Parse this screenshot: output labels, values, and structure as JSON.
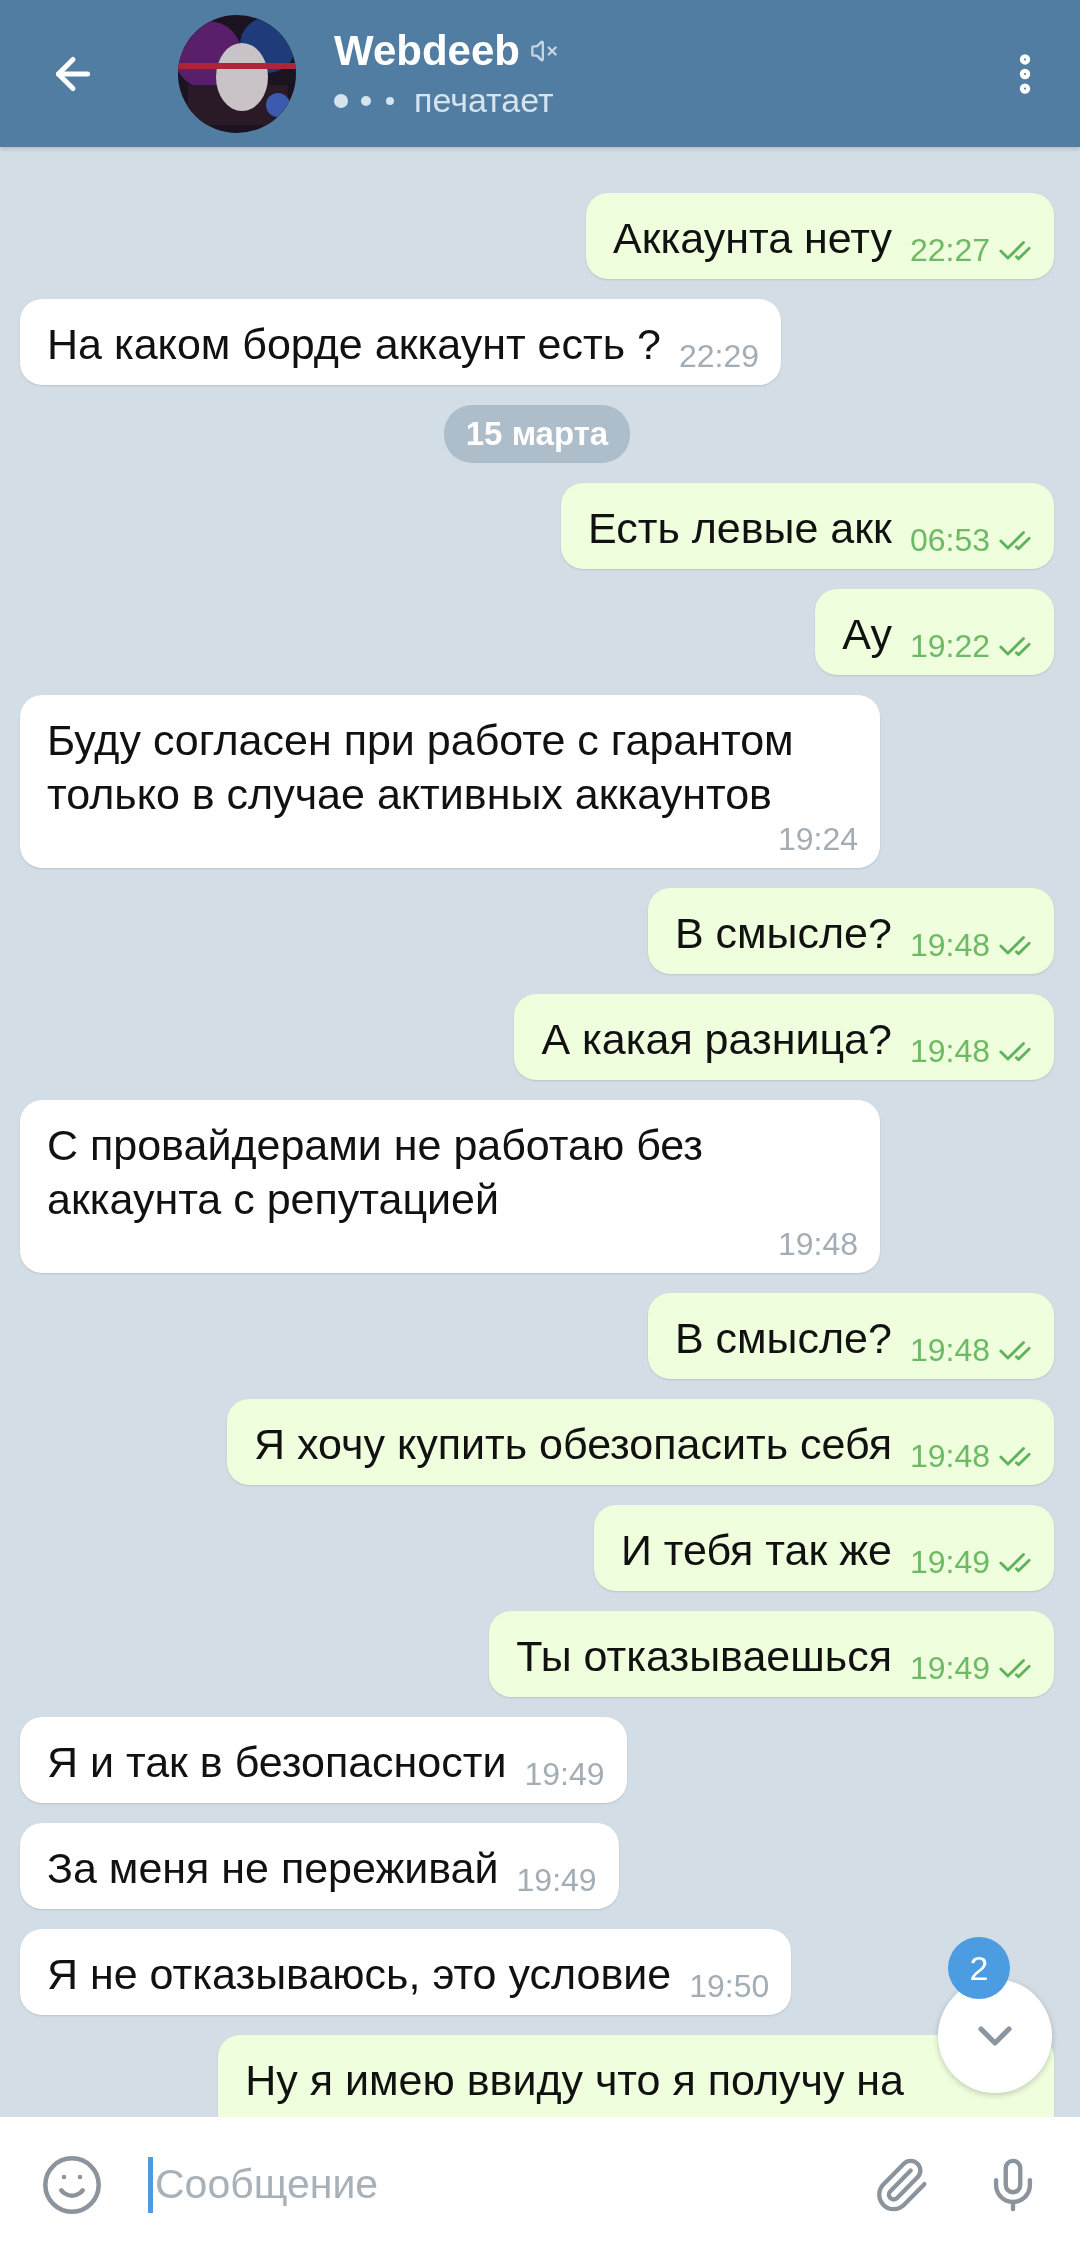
{
  "header": {
    "name": "Webdeeb",
    "muted": true,
    "status": "печатает"
  },
  "messages": [
    {
      "kind": "out",
      "text": "Аккаунта нету",
      "time": "22:27",
      "read": true
    },
    {
      "kind": "in",
      "text": "На каком борде аккаунт есть ?",
      "time": "22:29"
    },
    {
      "kind": "date",
      "text": "15 марта"
    },
    {
      "kind": "out",
      "text": "Есть левые акк",
      "time": "06:53",
      "read": true
    },
    {
      "kind": "out",
      "text": "Ау",
      "time": "19:22",
      "read": true
    },
    {
      "kind": "in",
      "text": "Буду согласен при работе с гарантом только в случае активных аккаунтов",
      "time": "19:24"
    },
    {
      "kind": "out",
      "text": "В смысле?",
      "time": "19:48",
      "read": true
    },
    {
      "kind": "out",
      "text": "А какая разница?",
      "time": "19:48",
      "read": true
    },
    {
      "kind": "in",
      "text": "С провайдерами не работаю без аккаунта с репутацией",
      "time": "19:48"
    },
    {
      "kind": "out",
      "text": "В смысле?",
      "time": "19:48",
      "read": true
    },
    {
      "kind": "out",
      "text": "Я хочу купить обезопасить себя",
      "time": "19:48",
      "read": true
    },
    {
      "kind": "out",
      "text": "И тебя так же",
      "time": "19:49",
      "read": true
    },
    {
      "kind": "out",
      "text": "Ты отказываешься",
      "time": "19:49",
      "read": true
    },
    {
      "kind": "in",
      "text": "Я и так в безопасности",
      "time": "19:49"
    },
    {
      "kind": "in",
      "text": "За меня не переживай",
      "time": "19:49"
    },
    {
      "kind": "in",
      "text": "Я не отказываюсь,  это условие",
      "time": "19:50"
    },
    {
      "kind": "out",
      "text": "Ну я имею ввиду что я получу на"
    }
  ],
  "scroll_button": {
    "unread_count": "2"
  },
  "composer": {
    "placeholder": "Сообщение"
  }
}
